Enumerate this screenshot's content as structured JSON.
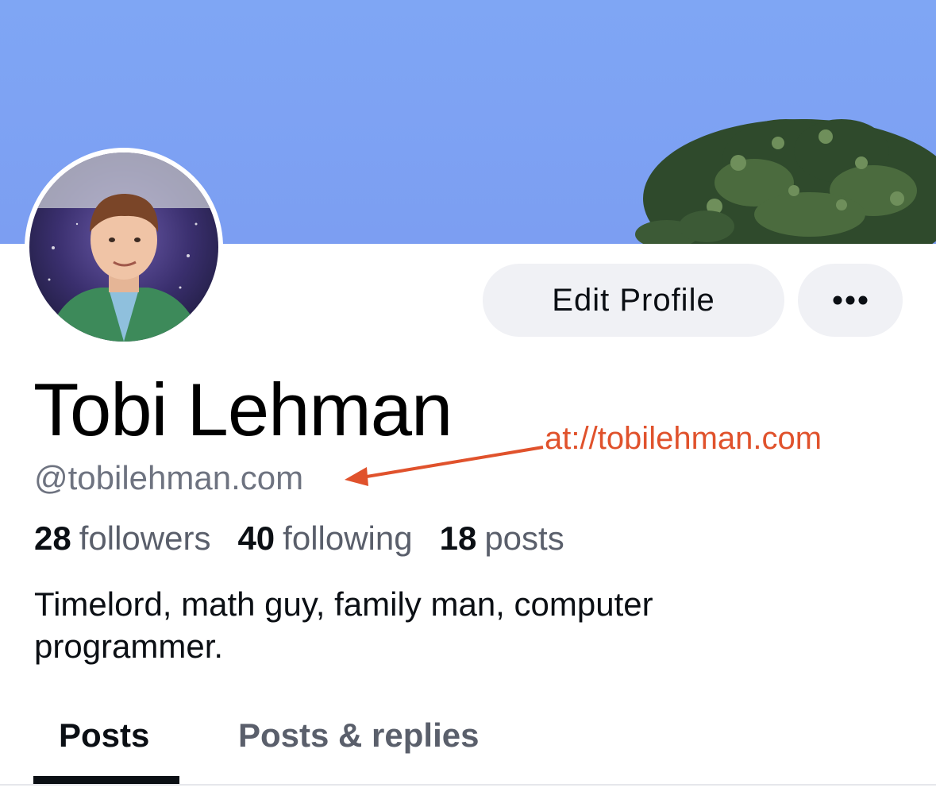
{
  "profile": {
    "display_name": "Tobi Lehman",
    "handle": "@tobilehman.com",
    "bio": "Timelord, math guy, family man, computer programmer."
  },
  "annotation": {
    "text": "at://tobilehman.com",
    "color": "#e0522c"
  },
  "actions": {
    "edit_profile_label": "Edit Profile",
    "more_icon": "ellipsis-icon"
  },
  "stats": {
    "followers_count": "28",
    "followers_label": "followers",
    "following_count": "40",
    "following_label": "following",
    "posts_count": "18",
    "posts_label": "posts"
  },
  "tabs": [
    {
      "label": "Posts",
      "active": true
    },
    {
      "label": "Posts & replies",
      "active": false
    }
  ],
  "colors": {
    "banner_sky": "#7fa6f4",
    "button_bg": "#f0f1f5",
    "secondary_text": "#6e7380"
  }
}
